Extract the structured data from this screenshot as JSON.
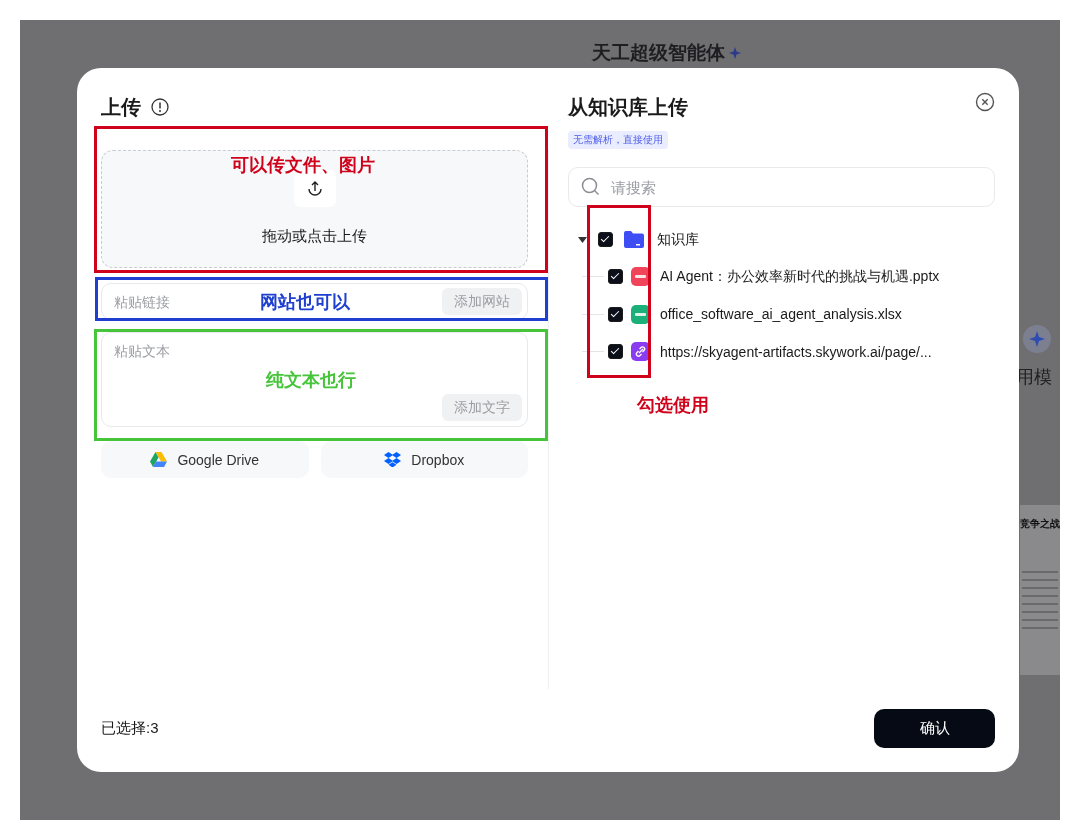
{
  "background": {
    "title": "天工超级智能体",
    "side_label": "用模",
    "doc_title": "竞争之战"
  },
  "upload": {
    "title": "上传",
    "dropzone_text": "拖动或点击上传",
    "link_field": {
      "placeholder": "粘贴链接",
      "button": "添加网站"
    },
    "text_field": {
      "placeholder": "粘贴文本",
      "button": "添加文字"
    },
    "sources": [
      {
        "kind": "google-drive",
        "label": "Google Drive"
      },
      {
        "kind": "dropbox",
        "label": "Dropbox"
      }
    ]
  },
  "knowledge": {
    "title": "从知识库上传",
    "tag": "无需解析，直接使用",
    "search": {
      "placeholder": "请搜索"
    },
    "tree": [
      {
        "kind": "folder",
        "label": "知识库",
        "checked": true,
        "expanded": true,
        "children": [
          {
            "kind": "pptx",
            "label": "AI Agent：办公效率新时代的挑战与机遇.pptx",
            "checked": true
          },
          {
            "kind": "xlsx",
            "label": "office_software_ai_agent_analysis.xlsx",
            "checked": true
          },
          {
            "kind": "link",
            "label": "https://skyagent-artifacts.skywork.ai/page/...",
            "checked": true
          }
        ]
      }
    ]
  },
  "footer": {
    "selected_count": "已选择:3",
    "confirm_button": "确认"
  },
  "annotations": [
    {
      "kind": "dropzone",
      "color": "#d0021b",
      "label": "可以传文件、图片"
    },
    {
      "kind": "link",
      "color": "#1f3fd0",
      "label": "网站也可以"
    },
    {
      "kind": "text",
      "color": "#46c43a",
      "label": "纯文本也行"
    },
    {
      "kind": "tree",
      "color": "#d0021b",
      "label": "勾选使用"
    }
  ]
}
